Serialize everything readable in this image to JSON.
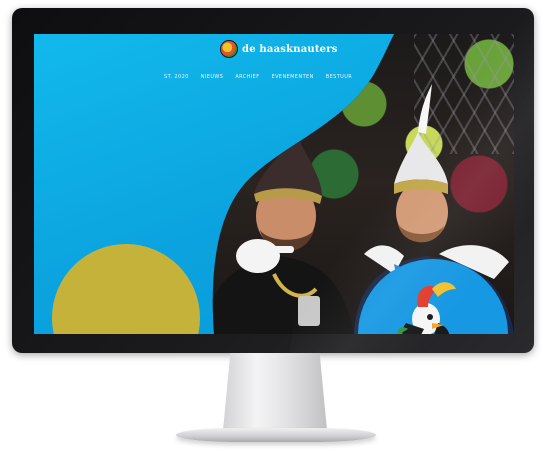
{
  "website": {
    "logo_text": "de haasknauters",
    "nav_items": [
      "ST. 2020",
      "NIEUWS",
      "ARCHIEF",
      "EVENEMENTEN",
      "BESTUUR"
    ]
  },
  "colors": {
    "screen_cyan": "#0ba3df",
    "yellow_circle": "#c5b23a",
    "blue_circle": "#1798e3",
    "bezel": "#141417"
  }
}
